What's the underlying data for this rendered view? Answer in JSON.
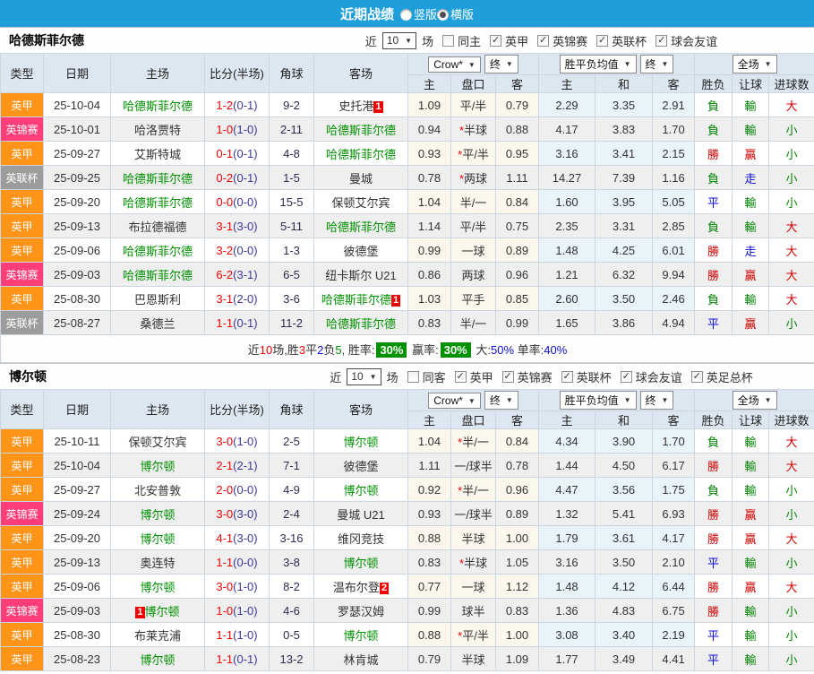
{
  "topbar": {
    "title": "近期战绩",
    "options": [
      {
        "label": "竖版",
        "selected": false
      },
      {
        "label": "横版",
        "selected": true
      }
    ]
  },
  "table_header": {
    "static_cols": [
      "类型",
      "日期",
      "主场",
      "比分(半场)",
      "角球",
      "客场"
    ],
    "odds_selects": [
      "Crow*",
      "终"
    ],
    "avg_selects": [
      "胜平负均值",
      "终"
    ],
    "full_select": "全场",
    "odds_cols": [
      "主",
      "盘口",
      "客"
    ],
    "avg_cols": [
      "主",
      "和",
      "客"
    ],
    "result_cols": [
      "胜负",
      "让球",
      "进球数"
    ]
  },
  "league_colors": {
    "英甲": "#ff9418",
    "英锦赛": "#ff3e79",
    "英联杯": "#9c9c9c"
  },
  "result_colors": {
    "勝": "red",
    "負": "green",
    "平": "blue",
    "贏": "red",
    "輸": "green",
    "走": "blue",
    "大": "red",
    "小": "green"
  },
  "sections": [
    {
      "team": "哈德斯菲尔德",
      "filters": {
        "prefix": "近",
        "count": "10",
        "suffix": "场",
        "same": {
          "label": "同主",
          "checked": false
        },
        "leagues": [
          {
            "label": "英甲",
            "checked": true
          },
          {
            "label": "英锦赛",
            "checked": true
          },
          {
            "label": "英联杯",
            "checked": true
          },
          {
            "label": "球会友谊",
            "checked": true
          }
        ]
      },
      "rows": [
        {
          "league": "英甲",
          "date": "25-10-04",
          "home": "哈德斯菲尔德",
          "home_focus": true,
          "home_badge": null,
          "home_badge_before": false,
          "score": "1-2",
          "half": "(0-1)",
          "corners": "9-2",
          "away": "史托港",
          "away_focus": false,
          "away_badge": "1",
          "odds": {
            "home": "1.09",
            "star": false,
            "handicap": "平/半",
            "away": "0.79"
          },
          "avg": [
            "2.29",
            "3.35",
            "2.91"
          ],
          "results": [
            "負",
            "輸",
            "大"
          ]
        },
        {
          "league": "英锦赛",
          "date": "25-10-01",
          "home": "哈洛贾特",
          "home_focus": false,
          "home_badge": null,
          "home_badge_before": false,
          "score": "1-0",
          "half": "(1-0)",
          "corners": "2-11",
          "away": "哈德斯菲尔德",
          "away_focus": true,
          "away_badge": null,
          "odds": {
            "home": "0.94",
            "star": true,
            "handicap": "半球",
            "away": "0.88"
          },
          "avg": [
            "4.17",
            "3.83",
            "1.70"
          ],
          "results": [
            "負",
            "輸",
            "小"
          ]
        },
        {
          "league": "英甲",
          "date": "25-09-27",
          "home": "艾斯特城",
          "home_focus": false,
          "home_badge": null,
          "home_badge_before": false,
          "score": "0-1",
          "half": "(0-1)",
          "corners": "4-8",
          "away": "哈德斯菲尔德",
          "away_focus": true,
          "away_badge": null,
          "odds": {
            "home": "0.93",
            "star": true,
            "handicap": "平/半",
            "away": "0.95"
          },
          "avg": [
            "3.16",
            "3.41",
            "2.15"
          ],
          "results": [
            "勝",
            "贏",
            "小"
          ]
        },
        {
          "league": "英联杯",
          "date": "25-09-25",
          "home": "哈德斯菲尔德",
          "home_focus": true,
          "home_badge": null,
          "home_badge_before": false,
          "score": "0-2",
          "half": "(0-1)",
          "corners": "1-5",
          "away": "曼城",
          "away_focus": false,
          "away_badge": null,
          "odds": {
            "home": "0.78",
            "star": true,
            "handicap": "两球",
            "away": "1.11"
          },
          "avg": [
            "14.27",
            "7.39",
            "1.16"
          ],
          "results": [
            "負",
            "走",
            "小"
          ]
        },
        {
          "league": "英甲",
          "date": "25-09-20",
          "home": "哈德斯菲尔德",
          "home_focus": true,
          "home_badge": null,
          "home_badge_before": false,
          "score": "0-0",
          "half": "(0-0)",
          "corners": "15-5",
          "away": "保顿艾尔宾",
          "away_focus": false,
          "away_badge": null,
          "odds": {
            "home": "1.04",
            "star": false,
            "handicap": "半/一",
            "away": "0.84"
          },
          "avg": [
            "1.60",
            "3.95",
            "5.05"
          ],
          "results": [
            "平",
            "輸",
            "小"
          ]
        },
        {
          "league": "英甲",
          "date": "25-09-13",
          "home": "布拉德福德",
          "home_focus": false,
          "home_badge": null,
          "home_badge_before": false,
          "score": "3-1",
          "half": "(3-0)",
          "corners": "5-11",
          "away": "哈德斯菲尔德",
          "away_focus": true,
          "away_badge": null,
          "odds": {
            "home": "1.14",
            "star": false,
            "handicap": "平/半",
            "away": "0.75"
          },
          "avg": [
            "2.35",
            "3.31",
            "2.85"
          ],
          "results": [
            "負",
            "輸",
            "大"
          ]
        },
        {
          "league": "英甲",
          "date": "25-09-06",
          "home": "哈德斯菲尔德",
          "home_focus": true,
          "home_badge": null,
          "home_badge_before": false,
          "score": "3-2",
          "half": "(0-0)",
          "corners": "1-3",
          "away": "彼德堡",
          "away_focus": false,
          "away_badge": null,
          "odds": {
            "home": "0.99",
            "star": false,
            "handicap": "一球",
            "away": "0.89"
          },
          "avg": [
            "1.48",
            "4.25",
            "6.01"
          ],
          "results": [
            "勝",
            "走",
            "大"
          ]
        },
        {
          "league": "英锦赛",
          "date": "25-09-03",
          "home": "哈德斯菲尔德",
          "home_focus": true,
          "home_badge": null,
          "home_badge_before": false,
          "score": "6-2",
          "half": "(3-1)",
          "corners": "6-5",
          "away": "纽卡斯尔 U21",
          "away_focus": false,
          "away_badge": null,
          "odds": {
            "home": "0.86",
            "star": false,
            "handicap": "两球",
            "away": "0.96"
          },
          "avg": [
            "1.21",
            "6.32",
            "9.94"
          ],
          "results": [
            "勝",
            "贏",
            "大"
          ]
        },
        {
          "league": "英甲",
          "date": "25-08-30",
          "home": "巴恩斯利",
          "home_focus": false,
          "home_badge": null,
          "home_badge_before": false,
          "score": "3-1",
          "half": "(2-0)",
          "corners": "3-6",
          "away": "哈德斯菲尔德",
          "away_focus": true,
          "away_badge": "1",
          "odds": {
            "home": "1.03",
            "star": false,
            "handicap": "平手",
            "away": "0.85"
          },
          "avg": [
            "2.60",
            "3.50",
            "2.46"
          ],
          "results": [
            "負",
            "輸",
            "大"
          ]
        },
        {
          "league": "英联杯",
          "date": "25-08-27",
          "home": "桑德兰",
          "home_focus": false,
          "home_badge": null,
          "home_badge_before": false,
          "score": "1-1",
          "half": "(0-1)",
          "corners": "11-2",
          "away": "哈德斯菲尔德",
          "away_focus": true,
          "away_badge": null,
          "odds": {
            "home": "0.83",
            "star": false,
            "handicap": "半/一",
            "away": "0.99"
          },
          "avg": [
            "1.65",
            "3.86",
            "4.94"
          ],
          "results": [
            "平",
            "贏",
            "小"
          ]
        }
      ],
      "summary": [
        {
          "text": "近",
          "color": "#333333"
        },
        {
          "text": "10",
          "color": "#f40000"
        },
        {
          "text": "场,胜",
          "color": "#333333"
        },
        {
          "text": "3",
          "color": "#f40000"
        },
        {
          "text": "平",
          "color": "#333333"
        },
        {
          "text": "2",
          "color": "#0d0dd6"
        },
        {
          "text": "负",
          "color": "#333333"
        },
        {
          "text": "5",
          "color": "#008400"
        },
        {
          "text": ", 胜率:",
          "color": "#333333"
        },
        {
          "badge": "30%"
        },
        {
          "text": " 赢率:",
          "color": "#333333"
        },
        {
          "badge": "30%"
        },
        {
          "text": " 大:",
          "color": "#333333"
        },
        {
          "text": "50%",
          "color": "#0d0dd6"
        },
        {
          "text": " 单率:",
          "color": "#333333"
        },
        {
          "text": "40%",
          "color": "#0d0dd6"
        }
      ]
    },
    {
      "team": "博尔顿",
      "filters": {
        "prefix": "近",
        "count": "10",
        "suffix": "场",
        "same": {
          "label": "同客",
          "checked": false
        },
        "leagues": [
          {
            "label": "英甲",
            "checked": true
          },
          {
            "label": "英锦赛",
            "checked": true
          },
          {
            "label": "英联杯",
            "checked": true
          },
          {
            "label": "球会友谊",
            "checked": true
          },
          {
            "label": "英足总杯",
            "checked": true
          }
        ]
      },
      "rows": [
        {
          "league": "英甲",
          "date": "25-10-11",
          "home": "保顿艾尔宾",
          "home_focus": false,
          "home_badge": null,
          "home_badge_before": false,
          "score": "3-0",
          "half": "(1-0)",
          "corners": "2-5",
          "away": "博尔顿",
          "away_focus": true,
          "away_badge": null,
          "odds": {
            "home": "1.04",
            "star": true,
            "handicap": "半/一",
            "away": "0.84"
          },
          "avg": [
            "4.34",
            "3.90",
            "1.70"
          ],
          "results": [
            "負",
            "輸",
            "大"
          ]
        },
        {
          "league": "英甲",
          "date": "25-10-04",
          "home": "博尔顿",
          "home_focus": true,
          "home_badge": null,
          "home_badge_before": false,
          "score": "2-1",
          "half": "(2-1)",
          "corners": "7-1",
          "away": "彼德堡",
          "away_focus": false,
          "away_badge": null,
          "odds": {
            "home": "1.11",
            "star": false,
            "handicap": "一/球半",
            "away": "0.78"
          },
          "avg": [
            "1.44",
            "4.50",
            "6.17"
          ],
          "results": [
            "勝",
            "輸",
            "大"
          ]
        },
        {
          "league": "英甲",
          "date": "25-09-27",
          "home": "北安普敦",
          "home_focus": false,
          "home_badge": null,
          "home_badge_before": false,
          "score": "2-0",
          "half": "(0-0)",
          "corners": "4-9",
          "away": "博尔顿",
          "away_focus": true,
          "away_badge": null,
          "odds": {
            "home": "0.92",
            "star": true,
            "handicap": "半/一",
            "away": "0.96"
          },
          "avg": [
            "4.47",
            "3.56",
            "1.75"
          ],
          "results": [
            "負",
            "輸",
            "小"
          ]
        },
        {
          "league": "英锦赛",
          "date": "25-09-24",
          "home": "博尔顿",
          "home_focus": true,
          "home_badge": null,
          "home_badge_before": false,
          "score": "3-0",
          "half": "(3-0)",
          "corners": "2-4",
          "away": "曼城 U21",
          "away_focus": false,
          "away_badge": null,
          "odds": {
            "home": "0.93",
            "star": false,
            "handicap": "一/球半",
            "away": "0.89"
          },
          "avg": [
            "1.32",
            "5.41",
            "6.93"
          ],
          "results": [
            "勝",
            "贏",
            "小"
          ]
        },
        {
          "league": "英甲",
          "date": "25-09-20",
          "home": "博尔顿",
          "home_focus": true,
          "home_badge": null,
          "home_badge_before": false,
          "score": "4-1",
          "half": "(3-0)",
          "corners": "3-16",
          "away": "维冈竞技",
          "away_focus": false,
          "away_badge": null,
          "odds": {
            "home": "0.88",
            "star": false,
            "handicap": "半球",
            "away": "1.00"
          },
          "avg": [
            "1.79",
            "3.61",
            "4.17"
          ],
          "results": [
            "勝",
            "贏",
            "大"
          ]
        },
        {
          "league": "英甲",
          "date": "25-09-13",
          "home": "奥连特",
          "home_focus": false,
          "home_badge": null,
          "home_badge_before": false,
          "score": "1-1",
          "half": "(0-0)",
          "corners": "3-8",
          "away": "博尔顿",
          "away_focus": true,
          "away_badge": null,
          "odds": {
            "home": "0.83",
            "star": true,
            "handicap": "半球",
            "away": "1.05"
          },
          "avg": [
            "3.16",
            "3.50",
            "2.10"
          ],
          "results": [
            "平",
            "輸",
            "小"
          ]
        },
        {
          "league": "英甲",
          "date": "25-09-06",
          "home": "博尔顿",
          "home_focus": true,
          "home_badge": null,
          "home_badge_before": false,
          "score": "3-0",
          "half": "(1-0)",
          "corners": "8-2",
          "away": "温布尔登",
          "away_focus": false,
          "away_badge": "2",
          "odds": {
            "home": "0.77",
            "star": false,
            "handicap": "一球",
            "away": "1.12"
          },
          "avg": [
            "1.48",
            "4.12",
            "6.44"
          ],
          "results": [
            "勝",
            "贏",
            "大"
          ]
        },
        {
          "league": "英锦赛",
          "date": "25-09-03",
          "home": "博尔顿",
          "home_focus": true,
          "home_badge": "1",
          "home_badge_before": true,
          "score": "1-0",
          "half": "(1-0)",
          "corners": "4-6",
          "away": "罗瑟汉姆",
          "away_focus": false,
          "away_badge": null,
          "odds": {
            "home": "0.99",
            "star": false,
            "handicap": "球半",
            "away": "0.83"
          },
          "avg": [
            "1.36",
            "4.83",
            "6.75"
          ],
          "results": [
            "勝",
            "輸",
            "小"
          ]
        },
        {
          "league": "英甲",
          "date": "25-08-30",
          "home": "布莱克浦",
          "home_focus": false,
          "home_badge": null,
          "home_badge_before": false,
          "score": "1-1",
          "half": "(1-0)",
          "corners": "0-5",
          "away": "博尔顿",
          "away_focus": true,
          "away_badge": null,
          "odds": {
            "home": "0.88",
            "star": true,
            "handicap": "平/半",
            "away": "1.00"
          },
          "avg": [
            "3.08",
            "3.40",
            "2.19"
          ],
          "results": [
            "平",
            "輸",
            "小"
          ]
        },
        {
          "league": "英甲",
          "date": "25-08-23",
          "home": "博尔顿",
          "home_focus": true,
          "home_badge": null,
          "home_badge_before": false,
          "score": "1-1",
          "half": "(0-1)",
          "corners": "13-2",
          "away": "林肯城",
          "away_focus": false,
          "away_badge": null,
          "odds": {
            "home": "0.79",
            "star": false,
            "handicap": "半球",
            "away": "1.09"
          },
          "avg": [
            "1.77",
            "3.49",
            "4.41"
          ],
          "results": [
            "平",
            "輸",
            "小"
          ]
        }
      ],
      "summary": null
    }
  ]
}
